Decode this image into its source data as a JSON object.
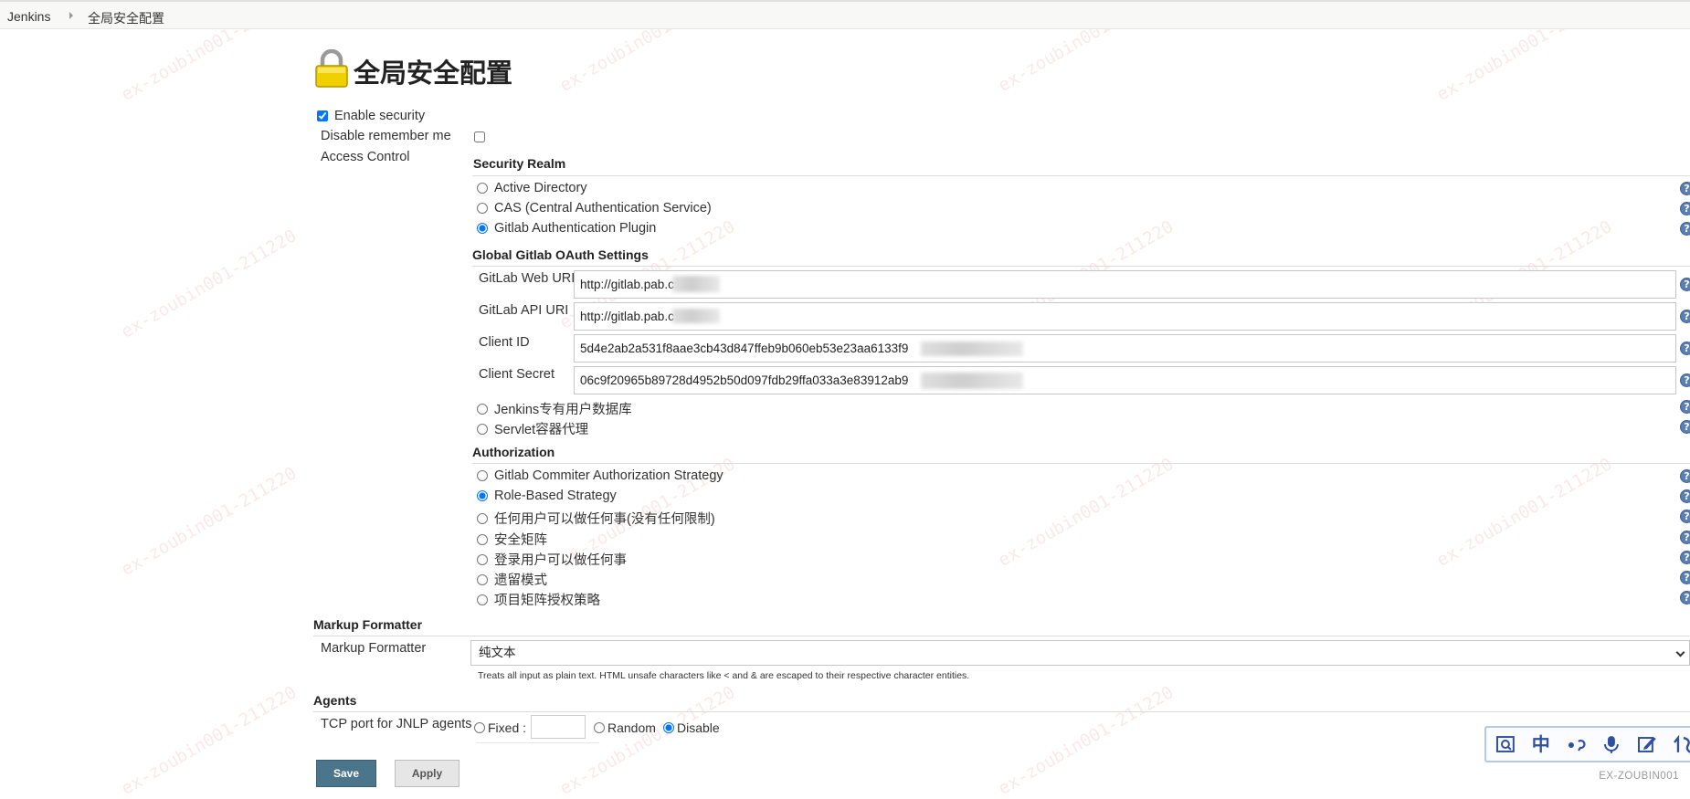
{
  "breadcrumb": {
    "root": "Jenkins",
    "current": "全局安全配置"
  },
  "page_title": "全局安全配置",
  "enable_security": {
    "label": "Enable security",
    "checked": true
  },
  "disable_remember_me": {
    "label": "Disable remember me",
    "checked": false
  },
  "access_control_label": "Access Control",
  "security_realm": {
    "heading": "Security Realm",
    "options": [
      {
        "label": "Active Directory",
        "selected": false
      },
      {
        "label": "CAS (Central Authentication Service)",
        "selected": false
      },
      {
        "label": "Gitlab Authentication Plugin",
        "selected": true
      }
    ],
    "oauth": {
      "heading": "Global Gitlab OAuth Settings",
      "fields": [
        {
          "label": "GitLab Web URI",
          "value": "http://gitlab.pab.c"
        },
        {
          "label": "GitLab API URI",
          "value": "http://gitlab.pab.c"
        },
        {
          "label": "Client ID",
          "value": "5d4e2ab2a531f8aae3cb43d847ffeb9b060eb53e23aa6133f9"
        },
        {
          "label": "Client Secret",
          "value": "06c9f20965b89728d4952b50d097fdb29ffa033a3e83912ab9"
        }
      ]
    },
    "more_options": [
      {
        "label": "Jenkins专有用户数据库",
        "selected": false
      },
      {
        "label": "Servlet容器代理",
        "selected": false
      }
    ]
  },
  "authorization": {
    "heading": "Authorization",
    "options": [
      {
        "label": "Gitlab Commiter Authorization Strategy",
        "selected": false
      },
      {
        "label": "Role-Based Strategy",
        "selected": true
      },
      {
        "label": "任何用户可以做任何事(没有任何限制)",
        "selected": false
      },
      {
        "label": "安全矩阵",
        "selected": false
      },
      {
        "label": "登录用户可以做任何事",
        "selected": false
      },
      {
        "label": "遗留模式",
        "selected": false
      },
      {
        "label": "项目矩阵授权策略",
        "selected": false
      }
    ]
  },
  "markup_formatter": {
    "heading": "Markup Formatter",
    "label": "Markup Formatter",
    "selected": "纯文本",
    "description": "Treats all input as plain text. HTML unsafe characters like < and & are escaped to their respective character entities."
  },
  "agents": {
    "heading": "Agents",
    "tcp_label": "TCP port for JNLP agents",
    "options": [
      {
        "label": "Fixed :",
        "selected": false
      },
      {
        "label": "Random",
        "selected": false
      },
      {
        "label": "Disable",
        "selected": true
      }
    ]
  },
  "buttons": {
    "save": "Save",
    "apply": "Apply"
  },
  "help_glyph": "?",
  "ime_toolbar": {
    "icons": [
      "screenshot-icon",
      "chinese-mode-icon",
      "punctuation-icon",
      "voice-icon",
      "handwriting-icon",
      "more-icon"
    ],
    "chinese_mode_glyph": "中"
  },
  "user_tag": "EX-ZOUBIN001",
  "watermark": "ex-zoubin001-211220",
  "colors": {
    "save_button": "#4b758b",
    "help_icon": "#5a7fb4",
    "lock": "#e8c200"
  }
}
